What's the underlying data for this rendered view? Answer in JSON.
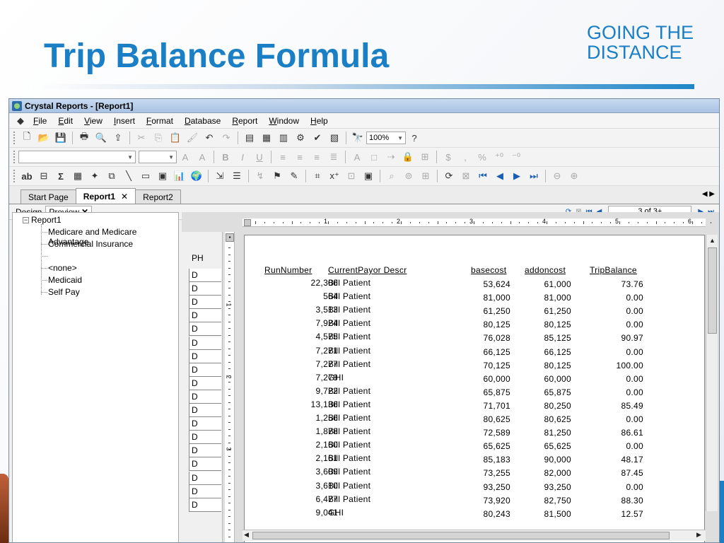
{
  "slide": {
    "title": "Trip Balance Formula",
    "logo_line1": "GOING THE",
    "logo_line2": "DISTANCE"
  },
  "window": {
    "title": "Crystal Reports - [Report1]"
  },
  "menu": [
    "File",
    "Edit",
    "View",
    "Insert",
    "Format",
    "Database",
    "Report",
    "Window",
    "Help"
  ],
  "toolbar": {
    "zoom": "100%"
  },
  "tabs": {
    "items": [
      "Start Page",
      "Report1",
      "Report2"
    ],
    "active": "Report1",
    "close_glyph": "✕"
  },
  "view_tabs": {
    "design": "Design",
    "preview": "Preview",
    "close_glyph": "✕"
  },
  "pagination": {
    "page_text": "3 of 3+"
  },
  "tree": {
    "root": "Report1",
    "nodes": [
      "Medicare and Medicare Advantage",
      "Commercial Insurance",
      "",
      "<none>",
      "Medicaid",
      "Self Pay"
    ]
  },
  "section_label": "PH",
  "detail_label": "D",
  "ruler_numbers": [
    "1",
    "2",
    "3",
    "4",
    "5",
    "6"
  ],
  "vruler_numbers": [
    "1",
    "2",
    "3"
  ],
  "report": {
    "columns": [
      "RunNumber",
      "CurrentPayor Descr",
      "basecost",
      "addoncost",
      "TripBalance"
    ],
    "rows": [
      [
        "22,306",
        "Bill Patient",
        "53,624",
        "61,000",
        "73.76"
      ],
      [
        "564",
        "Bill Patient",
        "81,000",
        "81,000",
        "0.00"
      ],
      [
        "3,513",
        "Bill Patient",
        "61,250",
        "61,250",
        "0.00"
      ],
      [
        "7,924",
        "Bill Patient",
        "80,125",
        "80,125",
        "0.00"
      ],
      [
        "4,575",
        "Bill Patient",
        "76,028",
        "85,125",
        "90.97"
      ],
      [
        "7,271",
        "Bill Patient",
        "66,125",
        "66,125",
        "0.00"
      ],
      [
        "7,277",
        "Bill Patient",
        "70,125",
        "80,125",
        "100.00"
      ],
      [
        "7,278",
        "GHI",
        "60,000",
        "60,000",
        "0.00"
      ],
      [
        "9,722",
        "Bill Patient",
        "65,875",
        "65,875",
        "0.00"
      ],
      [
        "13,136",
        "Bill Patient",
        "71,701",
        "80,250",
        "85.49"
      ],
      [
        "1,256",
        "Bill Patient",
        "80,625",
        "80,625",
        "0.00"
      ],
      [
        "1,878",
        "Bill Patient",
        "72,589",
        "81,250",
        "86.61"
      ],
      [
        "2,160",
        "Bill Patient",
        "65,625",
        "65,625",
        "0.00"
      ],
      [
        "2,161",
        "Bill Patient",
        "85,183",
        "90,000",
        "48.17"
      ],
      [
        "3,609",
        "Bill Patient",
        "73,255",
        "82,000",
        "87.45"
      ],
      [
        "3,610",
        "Bill Patient",
        "93,250",
        "93,250",
        "0.00"
      ],
      [
        "6,477",
        "Bill Patient",
        "73,920",
        "82,750",
        "88.30"
      ],
      [
        "9,041",
        "GHI",
        "80,243",
        "81,500",
        "12.57"
      ]
    ]
  },
  "colors": {
    "title_blue": "#1a7fc4",
    "titlebar": "#a9c3e3"
  }
}
